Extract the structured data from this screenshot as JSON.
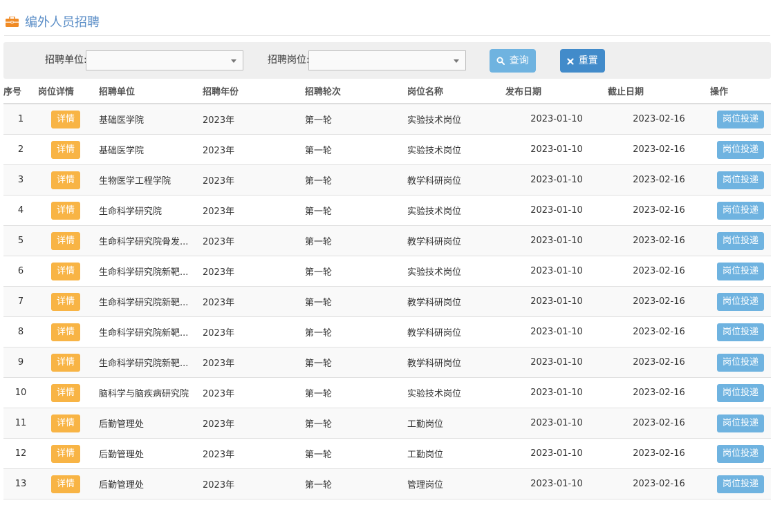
{
  "colors": {
    "title": "#5b8ec7",
    "header_icon": "#f08a24",
    "query_button": "#6fb3e0",
    "reset_button": "#428bca",
    "detail_badge": "#f8b445",
    "apply_button": "#6fb3e0"
  },
  "header": {
    "icon": "briefcase-icon",
    "title": "编外人员招聘"
  },
  "search": {
    "unit_label": "招聘单位:",
    "unit_value": "",
    "position_label": "招聘岗位:",
    "position_value": "",
    "query_label": "查询",
    "query_icon": "search-icon",
    "reset_label": "重置",
    "reset_icon": "close-icon"
  },
  "table": {
    "columns": [
      "序号",
      "岗位详情",
      "招聘单位",
      "招聘年份",
      "招聘轮次",
      "岗位名称",
      "发布日期",
      "截止日期",
      "操作"
    ],
    "detail_label": "详情",
    "apply_label": "岗位投递",
    "rows": [
      {
        "no": "1",
        "unit": "基础医学院",
        "year": "2023年",
        "round": "第一轮",
        "post": "实验技术岗位",
        "publish": "2023-01-10",
        "deadline": "2023-02-16"
      },
      {
        "no": "2",
        "unit": "基础医学院",
        "year": "2023年",
        "round": "第一轮",
        "post": "实验技术岗位",
        "publish": "2023-01-10",
        "deadline": "2023-02-16"
      },
      {
        "no": "3",
        "unit": "生物医学工程学院",
        "year": "2023年",
        "round": "第一轮",
        "post": "教学科研岗位",
        "publish": "2023-01-10",
        "deadline": "2023-02-16"
      },
      {
        "no": "4",
        "unit": "生命科学研究院",
        "year": "2023年",
        "round": "第一轮",
        "post": "实验技术岗位",
        "publish": "2023-01-10",
        "deadline": "2023-02-16"
      },
      {
        "no": "5",
        "unit": "生命科学研究院骨发...",
        "year": "2023年",
        "round": "第一轮",
        "post": "教学科研岗位",
        "publish": "2023-01-10",
        "deadline": "2023-02-16"
      },
      {
        "no": "6",
        "unit": "生命科学研究院新靶...",
        "year": "2023年",
        "round": "第一轮",
        "post": "实验技术岗位",
        "publish": "2023-01-10",
        "deadline": "2023-02-16"
      },
      {
        "no": "7",
        "unit": "生命科学研究院新靶...",
        "year": "2023年",
        "round": "第一轮",
        "post": "教学科研岗位",
        "publish": "2023-01-10",
        "deadline": "2023-02-16"
      },
      {
        "no": "8",
        "unit": "生命科学研究院新靶...",
        "year": "2023年",
        "round": "第一轮",
        "post": "教学科研岗位",
        "publish": "2023-01-10",
        "deadline": "2023-02-16"
      },
      {
        "no": "9",
        "unit": "生命科学研究院新靶...",
        "year": "2023年",
        "round": "第一轮",
        "post": "教学科研岗位",
        "publish": "2023-01-10",
        "deadline": "2023-02-16"
      },
      {
        "no": "10",
        "unit": "脑科学与脑疾病研究院",
        "year": "2023年",
        "round": "第一轮",
        "post": "实验技术岗位",
        "publish": "2023-01-10",
        "deadline": "2023-02-16"
      },
      {
        "no": "11",
        "unit": "后勤管理处",
        "year": "2023年",
        "round": "第一轮",
        "post": "工勤岗位",
        "publish": "2023-01-10",
        "deadline": "2023-02-16"
      },
      {
        "no": "12",
        "unit": "后勤管理处",
        "year": "2023年",
        "round": "第一轮",
        "post": "工勤岗位",
        "publish": "2023-01-10",
        "deadline": "2023-02-16"
      },
      {
        "no": "13",
        "unit": "后勤管理处",
        "year": "2023年",
        "round": "第一轮",
        "post": "管理岗位",
        "publish": "2023-01-10",
        "deadline": "2023-02-16"
      }
    ]
  }
}
